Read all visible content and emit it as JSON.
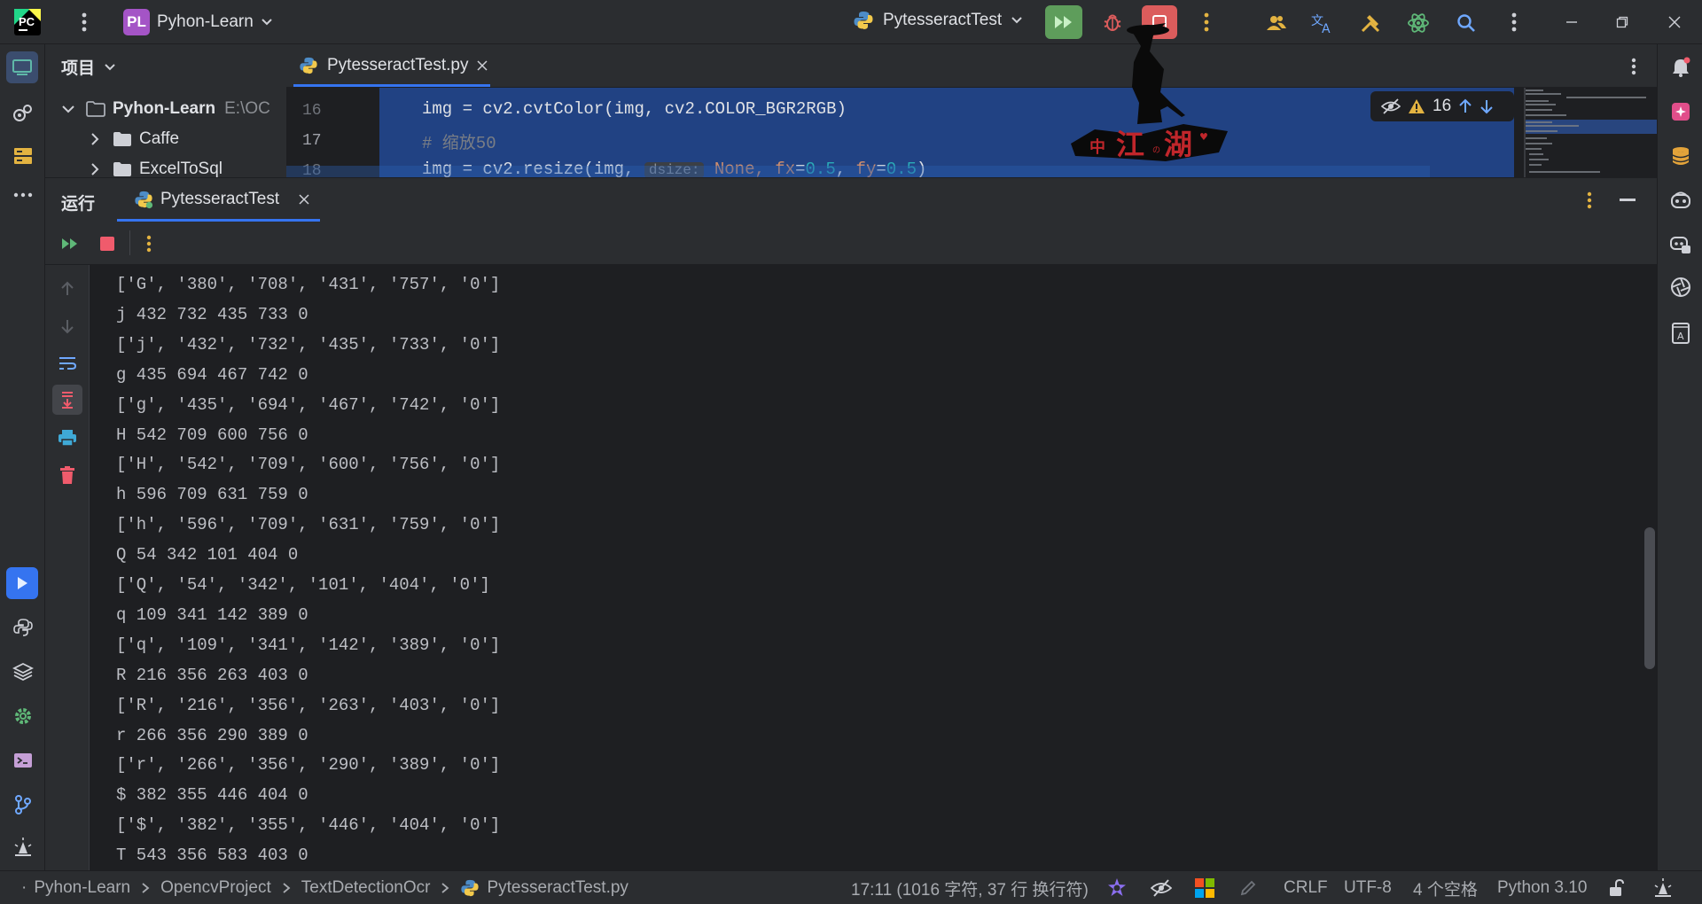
{
  "titlebar": {
    "project_badge": "PL",
    "project_name": "Pyhon-Learn",
    "run_config": "PytesseractTest"
  },
  "project_panel": {
    "title": "项目",
    "root_name": "Pyhon-Learn",
    "root_path": "E:\\OC",
    "items": [
      "Caffe",
      "ExcelToSql"
    ]
  },
  "editor": {
    "tab_label": "PytesseractTest.py",
    "inspection_count": "16",
    "lines": [
      {
        "num": "16",
        "code": "img = cv2.cvtColor(img, cv2.COLOR_BGR2RGB)"
      },
      {
        "num": "17",
        "code": "# 缩放50"
      },
      {
        "num": "18",
        "code_prefix": "img = cv2.resize(img,",
        "hint": "dsize:",
        "code_suffix_kw1": "None,",
        "param1": "fx",
        "val1": "0.5",
        "param2": "fy",
        "val2": "0.5"
      }
    ]
  },
  "run_panel": {
    "title": "运行",
    "tab_label": "PytesseractTest"
  },
  "console": {
    "lines": [
      "['G', '380', '708', '431', '757', '0']",
      "j 432 732 435 733 0",
      "['j', '432', '732', '435', '733', '0']",
      "g 435 694 467 742 0",
      "['g', '435', '694', '467', '742', '0']",
      "H 542 709 600 756 0",
      "['H', '542', '709', '600', '756', '0']",
      "h 596 709 631 759 0",
      "['h', '596', '709', '631', '759', '0']",
      "Q 54 342 101 404 0",
      "['Q', '54', '342', '101', '404', '0']",
      "q 109 341 142 389 0",
      "['q', '109', '341', '142', '389', '0']",
      "R 216 356 263 403 0",
      "['R', '216', '356', '263', '403', '0']",
      "r 266 356 290 389 0",
      "['r', '266', '356', '290', '389', '0']",
      "$ 382 355 446 404 0",
      "['$', '382', '355', '446', '404', '0']",
      "T 543 356 583 403 0"
    ]
  },
  "statusbar": {
    "breadcrumbs": [
      "Pyhon-Learn",
      "OpencvProject",
      "TextDetectionOcr",
      "PytesseractTest.py"
    ],
    "position": "17:11 (1016 字符, 37 行 换行符)",
    "line_sep": "CRLF",
    "encoding": "UTF-8",
    "indent": "4 个空格",
    "interpreter": "Python 3.10"
  },
  "colors": {
    "accent": "#3574f0",
    "run_green": "#5e9d5b",
    "stop_red": "#db5c5c",
    "selection": "#214283"
  }
}
